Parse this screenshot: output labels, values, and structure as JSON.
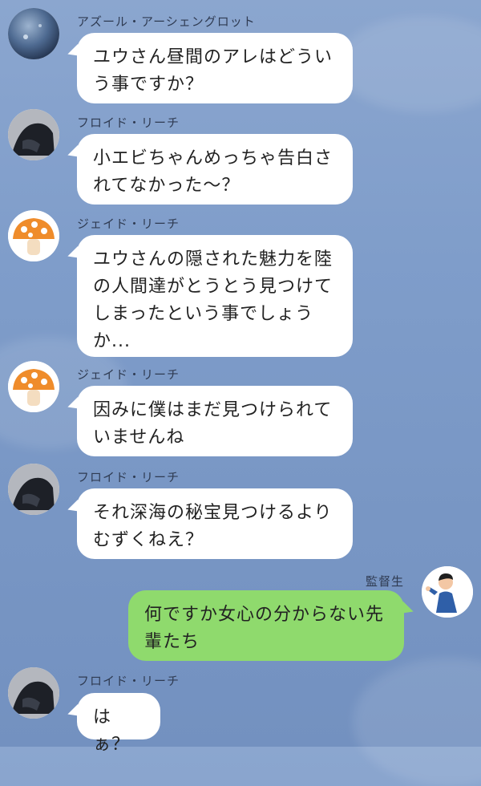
{
  "colors": {
    "background": "#7f9dca",
    "bubble_incoming": "#ffffff",
    "bubble_outgoing": "#8fda6d",
    "name_text": "#2f3b52",
    "message_text": "#222222"
  },
  "messages": [
    {
      "sender": "アズール・アーシェングロット",
      "avatar_icon": "dark-orb-avatar",
      "text": "ユウさん昼間のアレはどうい\nう事ですか？"
    },
    {
      "sender": "フロイド・リーチ",
      "avatar_icon": "dark-character-avatar",
      "text": "小エビちゃんめっちゃ告白さ\nれてなかった〜？"
    },
    {
      "sender": "ジェイド・リーチ",
      "avatar_icon": "mushroom-avatar",
      "text": "ユウさんの隠された魅力を陸\nの人間達がとうとう見つけて\nしまったという事でしょう\nか..."
    },
    {
      "sender": "ジェイド・リーチ",
      "avatar_icon": "mushroom-avatar",
      "text": "因みに僕はまだ見つけられて\nいませんね"
    },
    {
      "sender": "フロイド・リーチ",
      "avatar_icon": "dark-character-avatar",
      "text": "それ深海の秘宝見つけるより\nむずくねえ？"
    },
    {
      "sender": "監督生",
      "avatar_icon": "person-avatar",
      "text": "何ですか女心の分からない先\n輩たち",
      "outgoing": true
    },
    {
      "sender": "フロイド・リーチ",
      "avatar_icon": "dark-character-avatar",
      "text": "はぁ？"
    }
  ]
}
